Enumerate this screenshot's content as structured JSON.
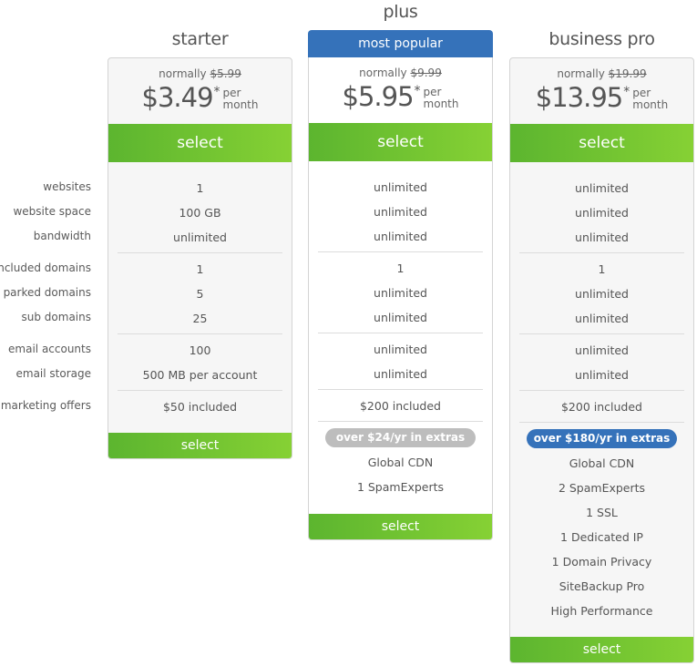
{
  "feature_labels": [
    "websites",
    "website space",
    "bandwidth",
    "included domains",
    "parked domains",
    "sub domains",
    "email accounts",
    "email storage",
    "marketing offers"
  ],
  "colors": {
    "accent_green_start": "#5cb52f",
    "accent_green_end": "#86d134",
    "popular_blue": "#3572ba",
    "extras_gray": "#bdbdbd"
  },
  "plans": [
    {
      "name": "starter",
      "normally_label": "normally",
      "normal_price": "$5.99",
      "price": "$3.49",
      "asterisk": "*",
      "per_line1": "per",
      "per_line2": "month",
      "select_label": "select",
      "features": [
        "1",
        "100 GB",
        "unlimited",
        "1",
        "5",
        "25",
        "100",
        "500 MB per account",
        "$50 included"
      ],
      "bottom_select_label": "select"
    },
    {
      "name": "plus",
      "badge": "most popular",
      "normally_label": "normally",
      "normal_price": "$9.99",
      "price": "$5.95",
      "asterisk": "*",
      "per_line1": "per",
      "per_line2": "month",
      "select_label": "select",
      "features": [
        "unlimited",
        "unlimited",
        "unlimited",
        "1",
        "unlimited",
        "unlimited",
        "unlimited",
        "unlimited",
        "$200 included"
      ],
      "extras_badge": "over $24/yr in extras",
      "extras": [
        "Global CDN",
        "1 SpamExperts"
      ],
      "bottom_select_label": "select"
    },
    {
      "name": "business pro",
      "normally_label": "normally",
      "normal_price": "$19.99",
      "price": "$13.95",
      "asterisk": "*",
      "per_line1": "per",
      "per_line2": "month",
      "select_label": "select",
      "features": [
        "unlimited",
        "unlimited",
        "unlimited",
        "1",
        "unlimited",
        "unlimited",
        "unlimited",
        "unlimited",
        "$200 included"
      ],
      "extras_badge": "over $180/yr in extras",
      "extras": [
        "Global CDN",
        "2 SpamExperts",
        "1 SSL",
        "1 Dedicated IP",
        "1 Domain Privacy",
        "SiteBackup Pro",
        "High Performance"
      ],
      "bottom_select_label": "select"
    }
  ]
}
